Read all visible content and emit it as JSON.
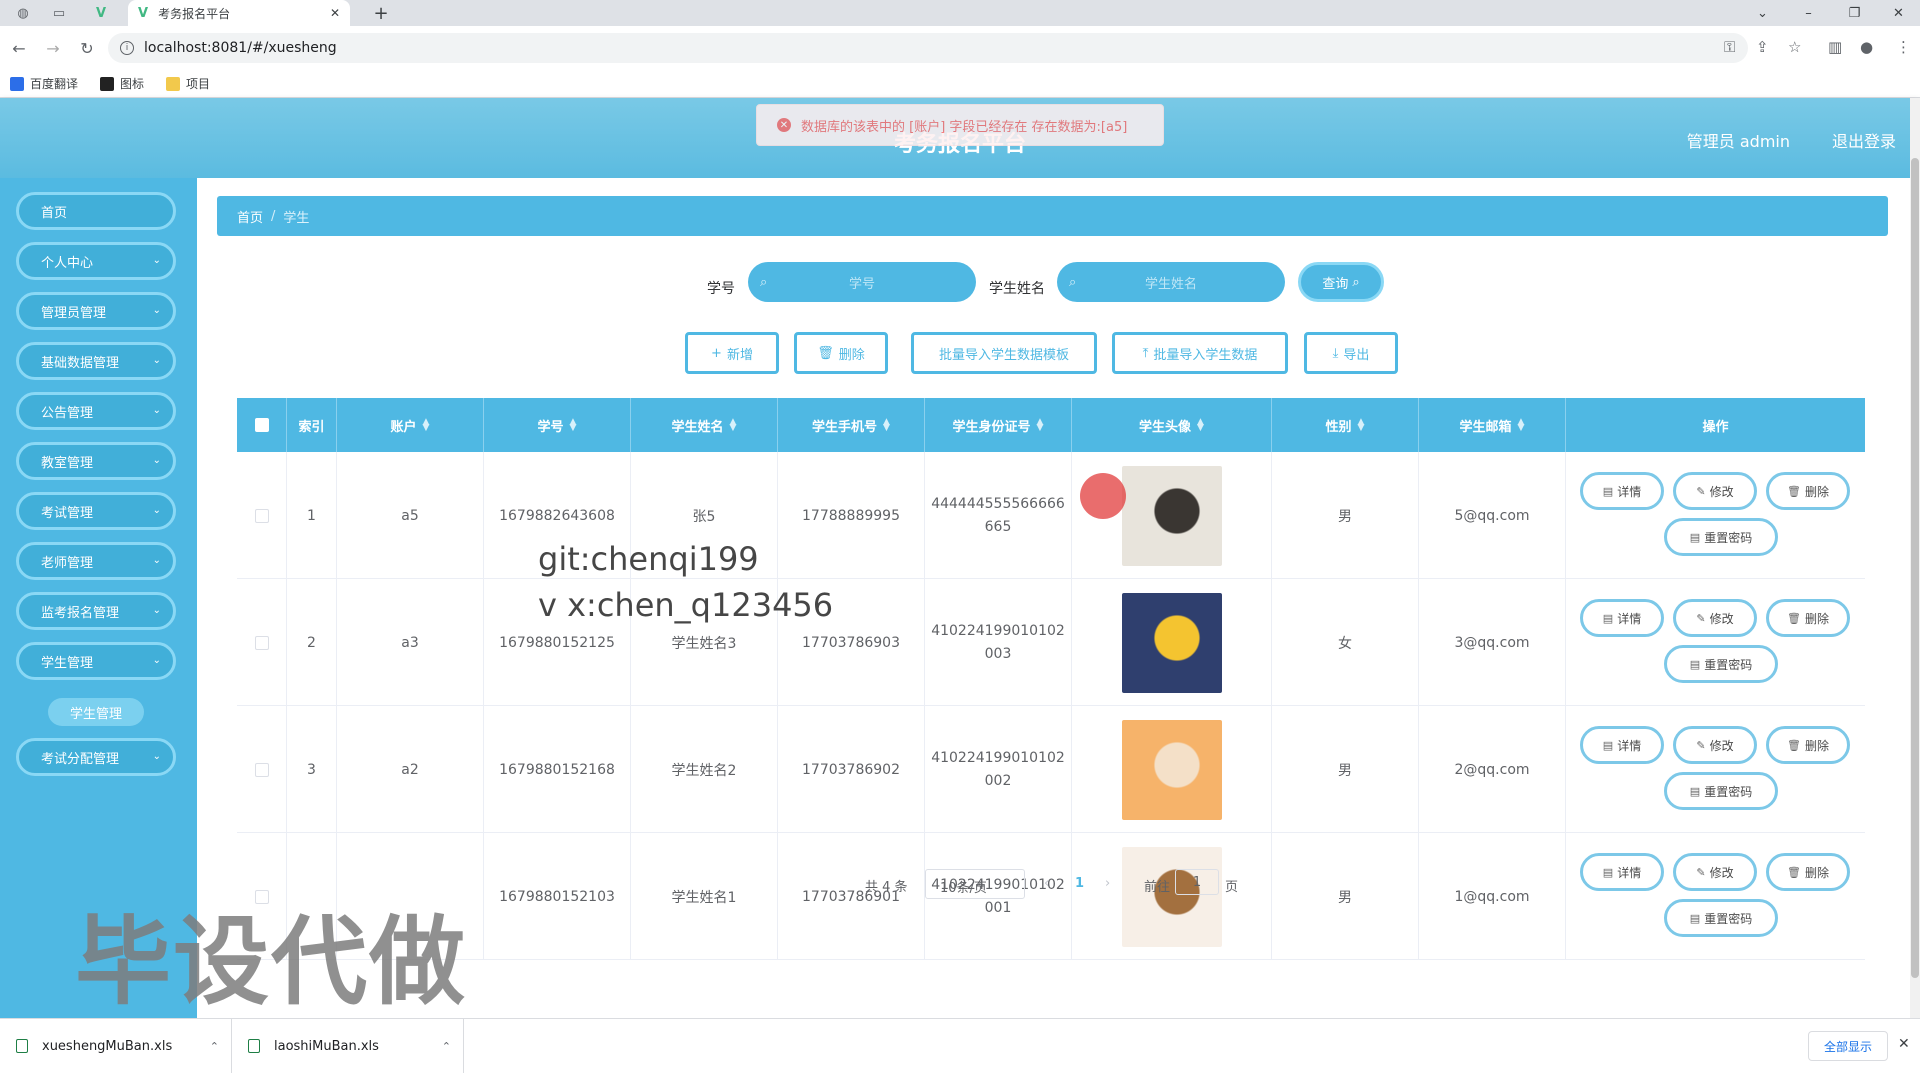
{
  "browser": {
    "tab_title": "考务报名平台",
    "url": "localhost:8081/#/xuesheng",
    "bookmarks": [
      "百度翻译",
      "图标",
      "项目"
    ]
  },
  "header": {
    "title": "考务报名平台",
    "user": "管理员 admin",
    "logout": "退出登录"
  },
  "toast": {
    "message": "数据库的该表中的 [账户] 字段已经存在 存在数据为:[a5]"
  },
  "sidebar": {
    "items": [
      {
        "label": "首页"
      },
      {
        "label": "个人中心"
      },
      {
        "label": "管理员管理"
      },
      {
        "label": "基础数据管理"
      },
      {
        "label": "公告管理"
      },
      {
        "label": "教室管理"
      },
      {
        "label": "考试管理"
      },
      {
        "label": "老师管理"
      },
      {
        "label": "监考报名管理"
      },
      {
        "label": "学生管理"
      },
      {
        "label": "考试分配管理"
      }
    ],
    "active_sub": "学生管理"
  },
  "breadcrumb": {
    "home": "首页",
    "sep": "/",
    "current": "学生"
  },
  "search": {
    "xuehao_label": "学号",
    "xuehao_placeholder": "学号",
    "name_label": "学生姓名",
    "name_placeholder": "学生姓名",
    "query": "查询"
  },
  "actions": {
    "add": "新增",
    "delete": "删除",
    "template": "批量导入学生数据模板",
    "import": "批量导入学生数据",
    "export": "导出"
  },
  "table": {
    "headers": [
      "索引",
      "账户",
      "学号",
      "学生姓名",
      "学生手机号",
      "学生身份证号",
      "学生头像",
      "性别",
      "学生邮箱",
      "操作"
    ],
    "rows": [
      {
        "index": "1",
        "account": "a5",
        "xuehao": "1679882643608",
        "name": "张5",
        "phone": "17788889995",
        "id_line1": "444444555566666",
        "id_line2": "665",
        "gender": "男",
        "email": "5@qq.com",
        "avatar_colors": [
          "#e8e4dc",
          "#3a3632"
        ]
      },
      {
        "index": "2",
        "account": "a3",
        "xuehao": "1679880152125",
        "name": "学生姓名3",
        "phone": "17703786903",
        "id_line1": "410224199010102",
        "id_line2": "003",
        "gender": "女",
        "email": "3@qq.com",
        "avatar_colors": [
          "#2f3f6e",
          "#f4c430"
        ]
      },
      {
        "index": "3",
        "account": "a2",
        "xuehao": "1679880152168",
        "name": "学生姓名2",
        "phone": "17703786902",
        "id_line1": "410224199010102",
        "id_line2": "002",
        "gender": "男",
        "email": "2@qq.com",
        "avatar_colors": [
          "#f6b36a",
          "#f4e0c8"
        ]
      },
      {
        "index": "",
        "account": "",
        "xuehao": "1679880152103",
        "name": "学生姓名1",
        "phone": "17703786901",
        "id_line1": "410224199010102",
        "id_line2": "001",
        "gender": "男",
        "email": "1@qq.com",
        "avatar_colors": [
          "#f7efe7",
          "#a3703f"
        ]
      }
    ],
    "ops": {
      "detail": "详情",
      "edit": "修改",
      "delete": "删除",
      "reset": "重置密码"
    }
  },
  "pager": {
    "total": "共 4 条",
    "size": "10条/页",
    "page": "1",
    "goto": "前往",
    "goto_value": "1",
    "page_suffix": "页"
  },
  "watermarks": {
    "git": "git:chenqi199",
    "wx": "v x:chen_q123456",
    "big": "毕设代做"
  },
  "downloads": {
    "files": [
      "xueshengMuBan.xls",
      "laoshiMuBan.xls"
    ],
    "show_all": "全部显示"
  }
}
